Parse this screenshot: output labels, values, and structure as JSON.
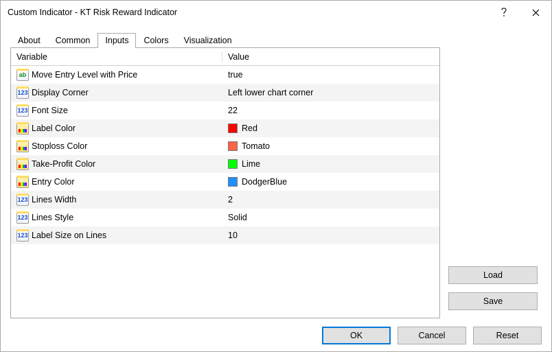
{
  "window": {
    "title": "Custom Indicator - KT Risk Reward Indicator"
  },
  "tabs": {
    "about": "About",
    "common": "Common",
    "inputs": "Inputs",
    "colors": "Colors",
    "visualization": "Visualization",
    "active": "inputs"
  },
  "table": {
    "header_variable": "Variable",
    "header_value": "Value",
    "rows": [
      {
        "icon": "str",
        "icon_glyph": "ab",
        "icon_name": "string-icon",
        "variable": "Move Entry Level with Price",
        "value": "true"
      },
      {
        "icon": "num",
        "icon_glyph": "123",
        "icon_name": "enum-icon",
        "variable": "Display Corner",
        "value": "Left lower chart corner"
      },
      {
        "icon": "num",
        "icon_glyph": "123",
        "icon_name": "number-icon",
        "variable": "Font Size",
        "value": "22"
      },
      {
        "icon": "clr",
        "icon_glyph": "",
        "icon_name": "color-icon",
        "variable": "Label Color",
        "value": "Red",
        "swatch": "#ff0000"
      },
      {
        "icon": "clr",
        "icon_glyph": "",
        "icon_name": "color-icon",
        "variable": "Stoploss Color",
        "value": "Tomato",
        "swatch": "#ff6347"
      },
      {
        "icon": "clr",
        "icon_glyph": "",
        "icon_name": "color-icon",
        "variable": "Take-Profit Color",
        "value": "Lime",
        "swatch": "#00ff00"
      },
      {
        "icon": "clr",
        "icon_glyph": "",
        "icon_name": "color-icon",
        "variable": "Entry Color",
        "value": "DodgerBlue",
        "swatch": "#1e90ff"
      },
      {
        "icon": "num",
        "icon_glyph": "123",
        "icon_name": "number-icon",
        "variable": "Lines Width",
        "value": "2"
      },
      {
        "icon": "num",
        "icon_glyph": "123",
        "icon_name": "enum-icon",
        "variable": "Lines Style",
        "value": "Solid"
      },
      {
        "icon": "num",
        "icon_glyph": "123",
        "icon_name": "number-icon",
        "variable": "Label Size on Lines",
        "value": "10"
      }
    ]
  },
  "buttons": {
    "load": "Load",
    "save": "Save",
    "ok": "OK",
    "cancel": "Cancel",
    "reset": "Reset"
  }
}
